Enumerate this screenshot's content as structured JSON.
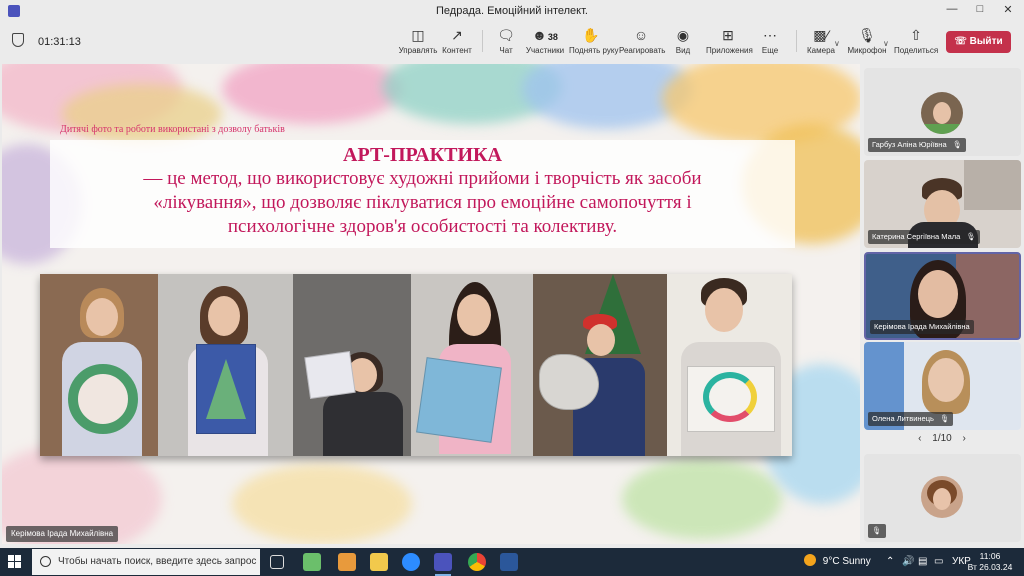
{
  "window": {
    "title": "Педрада. Емоційний інтелект."
  },
  "meeting": {
    "timer": "01:31:13",
    "toolbar": [
      {
        "icon": "manage-icon",
        "label": "Управлять"
      },
      {
        "icon": "content-icon",
        "label": "Контент"
      },
      {
        "icon": "chat-icon",
        "label": "Чат"
      },
      {
        "icon": "participants-icon",
        "label": "Участники",
        "count": "38"
      },
      {
        "icon": "raise-hand-icon",
        "label": "Поднять руку"
      },
      {
        "icon": "react-icon",
        "label": "Реагировать"
      },
      {
        "icon": "view-icon",
        "label": "Вид"
      },
      {
        "icon": "apps-icon",
        "label": "Приложения"
      },
      {
        "icon": "more-icon",
        "label": "Еще"
      },
      {
        "icon": "camera-icon",
        "label": "Камера"
      },
      {
        "icon": "microphone-icon",
        "label": "Микрофон"
      },
      {
        "icon": "share-icon",
        "label": "Поделиться"
      }
    ],
    "leave_label": "Выйти"
  },
  "slide": {
    "caption": "Дитячі фото та роботи використані з дозволу батьків",
    "heading": "АРТ-ПРАКТИКА",
    "body_lines": [
      "— це метод, що використовує художні прийоми і творчість як засоби",
      "«лікування», що дозволяє піклуватися про емоційне самопочуття і",
      "психологічне здоров'я особистості та колективу."
    ]
  },
  "presenter_label": "Керімова Ірада Михайлівна",
  "participants": [
    {
      "name": "Гарбуз Аліна Юріївна",
      "muted": true
    },
    {
      "name": "Катерина Сергіївна Мала",
      "muted": true
    },
    {
      "name": "Керімова Ірада Михайлівна",
      "muted": false,
      "active": true
    },
    {
      "name": "Олена Литвинець",
      "muted": true
    }
  ],
  "pager": {
    "label": "1/10"
  },
  "taskbar": {
    "search_placeholder": "Чтобы начать поиск, введите здесь запрос",
    "weather": "9°C  Sunny",
    "language": "УКР",
    "time": "11:06",
    "date": "Вт 26.03.24"
  },
  "colors": {
    "leave": "#c4314b",
    "slide_text": "#c2185b",
    "active_tile_border": "#6264a7"
  }
}
